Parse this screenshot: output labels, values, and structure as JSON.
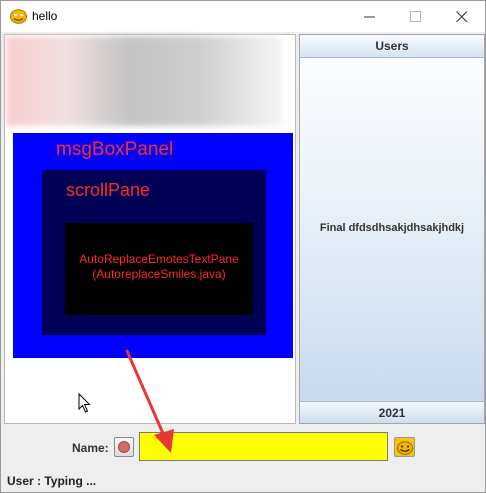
{
  "window": {
    "title": "hello",
    "icons": {
      "app": "smiley-icon",
      "minimize": "minimize-icon",
      "maximize": "maximize-icon",
      "close": "close-icon"
    }
  },
  "chat": {
    "msgbox_panel_label": "msgBoxPanel",
    "scroll_pane_label": "scrollPane",
    "text_pane_label_line1": "AutoReplaceEmotesTextPane",
    "text_pane_label_line2": "(AutoreplaceSmiles.java)"
  },
  "users": {
    "header": "Users",
    "entries": [
      "Final dfdsdhsakjdhsakjhdkj"
    ],
    "footer": "2021"
  },
  "input": {
    "name_label": "Name:",
    "value": ""
  },
  "status": {
    "text": "User : Typing ..."
  },
  "colors": {
    "msgbox_panel": "#0000ff",
    "scroll_pane": "#000055",
    "text_pane": "#000000",
    "annotation_text": "#ff2a2a",
    "input_background": "#ffff00",
    "arrow": "#e53935"
  }
}
